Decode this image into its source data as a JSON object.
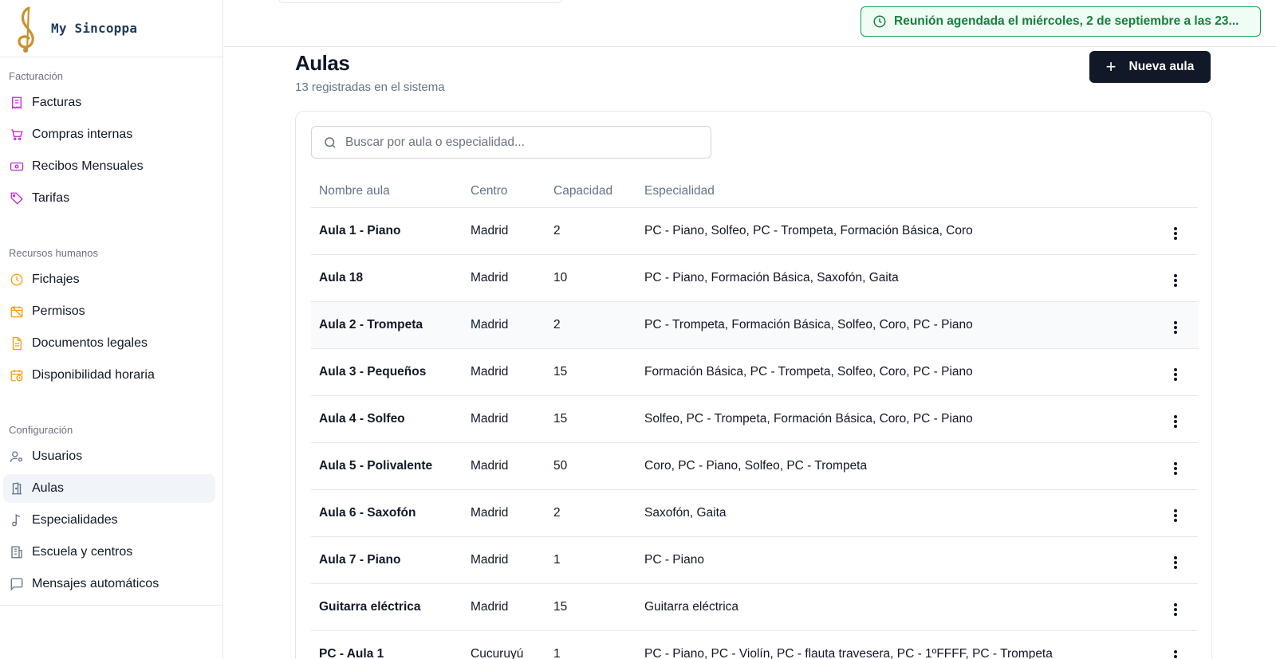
{
  "app": {
    "name": "My Sincoppa"
  },
  "sidebar": {
    "sections": [
      {
        "title": "Facturación",
        "items": [
          {
            "label": "Facturas",
            "icon": "receipt-icon"
          },
          {
            "label": "Compras internas",
            "icon": "cart-icon"
          },
          {
            "label": "Recibos Mensuales",
            "icon": "banknote-icon"
          },
          {
            "label": "Tarifas",
            "icon": "tag-icon"
          }
        ]
      },
      {
        "title": "Recursos humanos",
        "items": [
          {
            "label": "Fichajes",
            "icon": "clock-icon"
          },
          {
            "label": "Permisos",
            "icon": "calendar-off-icon"
          },
          {
            "label": "Documentos legales",
            "icon": "document-icon"
          },
          {
            "label": "Disponibilidad horaria",
            "icon": "calendar-clock-icon"
          }
        ]
      },
      {
        "title": "Configuración",
        "items": [
          {
            "label": "Usuarios",
            "icon": "user-cog-icon"
          },
          {
            "label": "Aulas",
            "icon": "door-icon",
            "active": true
          },
          {
            "label": "Especialidades",
            "icon": "music-note-icon"
          },
          {
            "label": "Escuela y centros",
            "icon": "building-icon"
          },
          {
            "label": "Mensajes automáticos",
            "icon": "message-icon"
          }
        ]
      }
    ]
  },
  "toast": {
    "text": "Reunión agendada el miércoles, 2 de septiembre a las 23...",
    "icon": "clock-icon"
  },
  "page": {
    "title": "Aulas",
    "subtitle": "13 registradas en el sistema",
    "new_button": "Nueva aula",
    "new_button_icon": "plus-icon"
  },
  "search": {
    "placeholder": "Buscar por aula o especialidad...",
    "value": ""
  },
  "table": {
    "headers": [
      "Nombre aula",
      "Centro",
      "Capacidad",
      "Especialidad"
    ],
    "rows": [
      [
        "Aula 1 - Piano",
        "Madrid",
        "2",
        "PC - Piano, Solfeo, PC - Trompeta, Formación Básica, Coro"
      ],
      [
        "Aula 18",
        "Madrid",
        "10",
        "PC - Piano, Formación Básica, Saxofón, Gaita"
      ],
      [
        "Aula 2 - Trompeta",
        "Madrid",
        "2",
        "PC - Trompeta, Formación Básica, Solfeo, Coro, PC - Piano"
      ],
      [
        "Aula 3 - Pequeños",
        "Madrid",
        "15",
        "Formación Básica, PC - Trompeta, Solfeo, Coro, PC - Piano"
      ],
      [
        "Aula 4 - Solfeo",
        "Madrid",
        "15",
        "Solfeo, PC - Trompeta, Formación Básica, Coro, PC - Piano"
      ],
      [
        "Aula 5 - Polivalente",
        "Madrid",
        "50",
        "Coro, PC - Piano, Solfeo, PC - Trompeta"
      ],
      [
        "Aula 6 - Saxofón",
        "Madrid",
        "2",
        "Saxofón, Gaita"
      ],
      [
        "Aula 7 - Piano",
        "Madrid",
        "1",
        "PC - Piano"
      ],
      [
        "Guitarra eléctrica",
        "Madrid",
        "15",
        "Guitarra eléctrica"
      ],
      [
        "PC - Aula 1",
        "Cucuruyú",
        "1",
        "PC - Piano, PC - Violín, PC - flauta travesera, PC - 1ºFFFF, PC - Trompeta"
      ]
    ]
  },
  "colors": {
    "accent_dark": "#111827",
    "toast_green": "#15803d",
    "icon_purple": "#c026d3",
    "icon_orange": "#f59e0b",
    "icon_gray": "#64748b",
    "logo_gold": "#c8912f",
    "logo_navy": "#1e3a5f"
  }
}
